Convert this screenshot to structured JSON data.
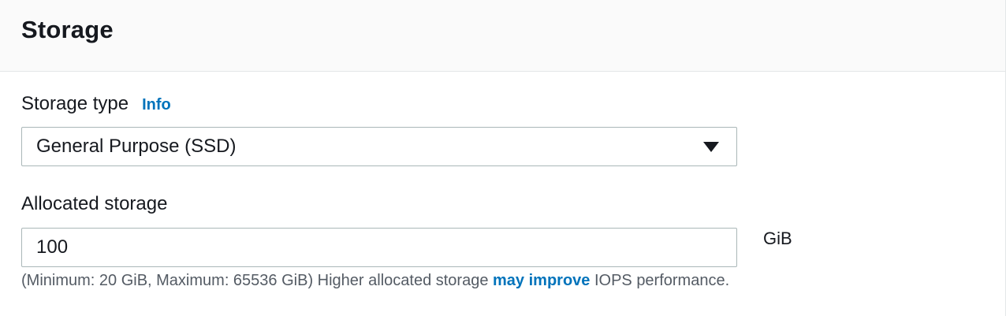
{
  "section": {
    "title": "Storage"
  },
  "storage_type": {
    "label": "Storage type",
    "info_link": "Info",
    "selected": "General Purpose (SSD)"
  },
  "allocated_storage": {
    "label": "Allocated storage",
    "value": "100",
    "unit": "GiB",
    "hint_prefix": "(Minimum: 20 GiB, Maximum: 65536 GiB) Higher allocated storage ",
    "hint_link": "may improve",
    "hint_suffix": " IOPS performance."
  },
  "colors": {
    "link": "#0073bb",
    "header_bg": "#fafafa",
    "border": "#aab7b8",
    "hint_text": "#545b64"
  },
  "icons": {
    "select_caret": "caret-down-icon"
  }
}
